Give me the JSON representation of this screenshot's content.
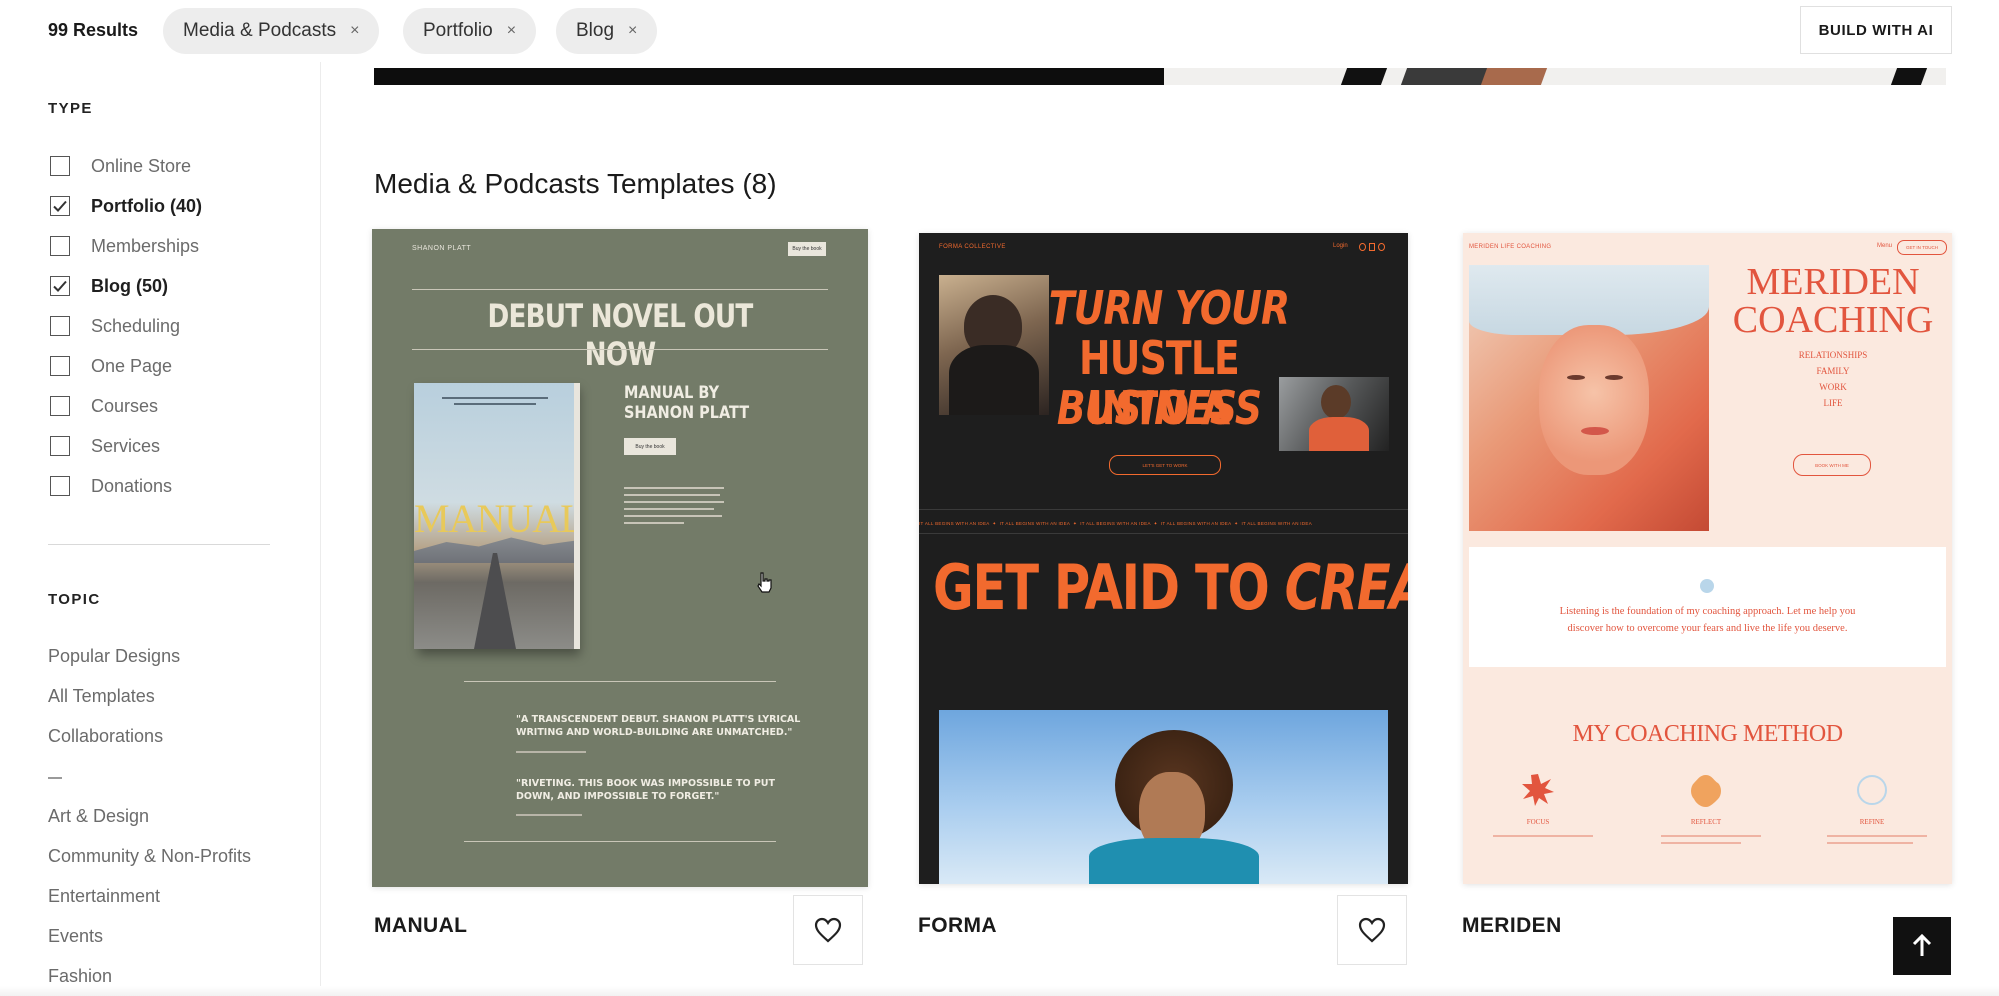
{
  "results_count": "99 Results",
  "filters": [
    {
      "label": "Media & Podcasts",
      "remove": "×"
    },
    {
      "label": "Portfolio",
      "remove": "×"
    },
    {
      "label": "Blog",
      "remove": "×"
    }
  ],
  "build_button": "BUILD WITH AI",
  "sidebar": {
    "type_title": "TYPE",
    "type_items": [
      {
        "label": "Online Store",
        "checked": false
      },
      {
        "label": "Portfolio (40)",
        "checked": true
      },
      {
        "label": "Memberships",
        "checked": false
      },
      {
        "label": "Blog (50)",
        "checked": true
      },
      {
        "label": "Scheduling",
        "checked": false
      },
      {
        "label": "One Page",
        "checked": false
      },
      {
        "label": "Courses",
        "checked": false
      },
      {
        "label": "Services",
        "checked": false
      },
      {
        "label": "Donations",
        "checked": false
      }
    ],
    "topic_title": "TOPIC",
    "topic_items": [
      "Popular Designs",
      "All Templates",
      "Collaborations",
      "Art & Design",
      "Community & Non-Profits",
      "Entertainment",
      "Events",
      "Fashion"
    ]
  },
  "main": {
    "heading": "Media & Podcasts Templates (8)",
    "cards": [
      {
        "name": "MANUAL",
        "brand": "SHANON PLATT",
        "nav_button": "Buy the book",
        "headline": "DEBUT NOVEL OUT NOW",
        "book_title": "MANUAL",
        "subtitle_line1": "MANUAL BY",
        "subtitle_line2": "SHANON PLATT",
        "buy_button": "Buy the book",
        "quote1_line1": "\"A TRANSCENDENT DEBUT. SHANON PLATT'S LYRICAL",
        "quote1_line2": "WRITING AND WORLD-BUILDING ARE UNMATCHED.\"",
        "quote2_line1": "\"RIVETING. THIS BOOK WAS IMPOSSIBLE TO PUT",
        "quote2_line2": "DOWN, AND IMPOSSIBLE TO FORGET.\""
      },
      {
        "name": "FORMA",
        "brand": "FORMA COLLECTIVE",
        "nav_login": "Login",
        "hero_line1": "TURN YOUR",
        "hero_line2": "HUSTLE INTO A",
        "hero_line3": "BUSINESS",
        "cta": "LET'S GET TO WORK",
        "ticker_item": "IT ALL BEGINS WITH AN IDEA",
        "section_plain": "GET PAID TO",
        "section_italic": "CREATE"
      },
      {
        "name": "MERIDEN",
        "brand": "MERIDEN LIFE COACHING",
        "nav_item": "Menu",
        "nav_button": "GET IN TOUCH",
        "title_line1": "MERIDEN",
        "title_line2": "COACHING",
        "topics": [
          "RELATIONSHIPS",
          "FAMILY",
          "WORK",
          "LIFE"
        ],
        "cta": "BOOK WITH ME",
        "intro_line1": "Listening is the foundation of my coaching approach. Let me help you",
        "intro_line2": "discover how to overcome your fears and live the life you deserve.",
        "method_title": "MY COACHING METHOD",
        "steps": [
          "FOCUS",
          "REFLECT",
          "REFINE"
        ]
      }
    ]
  },
  "colors": {
    "manual_bg": "#737b68",
    "forma_bg": "#1e1e1e",
    "forma_accent": "#f26a2e",
    "meriden_bg": "#fbe9df",
    "meriden_accent": "#e2553e"
  },
  "icons": [
    "close-icon",
    "check-icon",
    "heart-icon",
    "arrow-up-icon",
    "cursor-icon"
  ]
}
